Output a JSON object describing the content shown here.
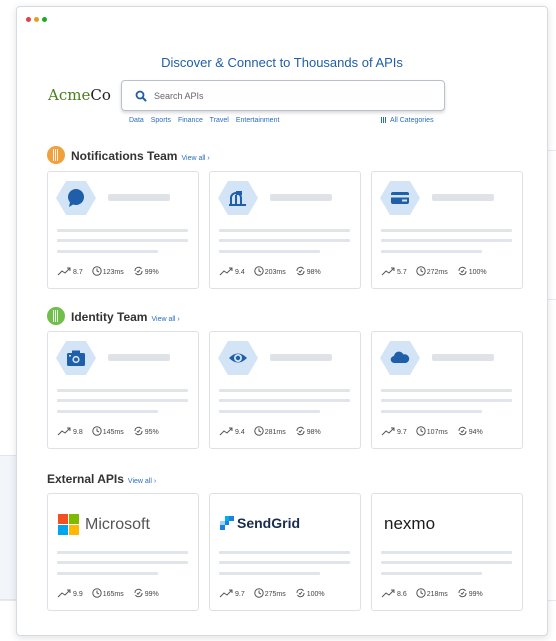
{
  "header": {
    "headline": "Discover & Connect to Thousands of APIs",
    "logo_part1": "Acme",
    "logo_part2": "Co"
  },
  "search": {
    "placeholder": "Search APIs",
    "categories": [
      "Data",
      "Sports",
      "Finance",
      "Travel",
      "Entertainment"
    ],
    "all_categories": "All Categories"
  },
  "sections": [
    {
      "title": "Notifications Team",
      "view_all": "View all ›",
      "icon_color": "#f0a13c",
      "cards": [
        {
          "icon": "chat-bubble-icon",
          "popularity": "8.7",
          "latency": "123ms",
          "success": "99%"
        },
        {
          "icon": "mailbox-icon",
          "popularity": "9.4",
          "latency": "203ms",
          "success": "98%"
        },
        {
          "icon": "credit-card-icon",
          "popularity": "5.7",
          "latency": "272ms",
          "success": "100%"
        }
      ]
    },
    {
      "title": "Identity Team",
      "view_all": "View all ›",
      "icon_color": "#6fbf4a",
      "cards": [
        {
          "icon": "camera-icon",
          "popularity": "9.8",
          "latency": "145ms",
          "success": "95%"
        },
        {
          "icon": "eye-icon",
          "popularity": "9.4",
          "latency": "281ms",
          "success": "98%"
        },
        {
          "icon": "cloud-icon",
          "popularity": "9.7",
          "latency": "107ms",
          "success": "94%"
        }
      ]
    },
    {
      "title": "External APIs",
      "view_all": "View all ›",
      "cards": [
        {
          "brand": "Microsoft",
          "popularity": "9.9",
          "latency": "165ms",
          "success": "99%"
        },
        {
          "brand": "SendGrid",
          "popularity": "9.7",
          "latency": "275ms",
          "success": "100%"
        },
        {
          "brand": "nexmo",
          "popularity": "8.6",
          "latency": "218ms",
          "success": "99%"
        }
      ]
    }
  ],
  "colors": {
    "headline": "#1f5ea8",
    "link": "#2a6dbd",
    "hex_bg": "#d3e4f6",
    "icon_blue": "#1f5ea8"
  }
}
